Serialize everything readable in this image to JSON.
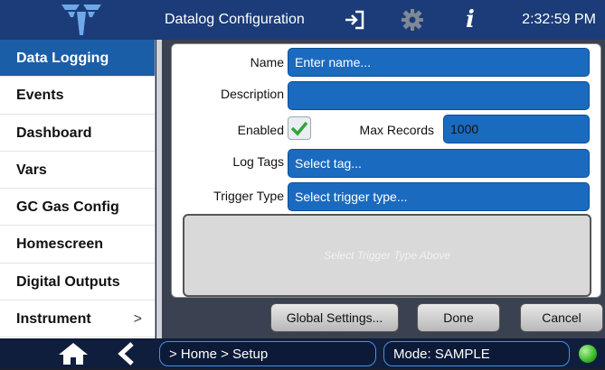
{
  "header": {
    "title": "Datalog Configuration",
    "time": "2:32:59 PM",
    "icons": [
      "teledyne-logo-icon",
      "exit-icon",
      "gear-icon",
      "info-icon"
    ]
  },
  "sidebar": {
    "items": [
      {
        "label": "Data Logging",
        "active": true
      },
      {
        "label": "Events"
      },
      {
        "label": "Dashboard"
      },
      {
        "label": "Vars"
      },
      {
        "label": "GC Gas Config"
      },
      {
        "label": "Homescreen"
      },
      {
        "label": "Digital Outputs"
      },
      {
        "label": "Instrument",
        "chevron": ">"
      }
    ]
  },
  "form": {
    "name_label": "Name",
    "name_placeholder": "Enter name...",
    "description_label": "Description",
    "description_value": "",
    "enabled_label": "Enabled",
    "enabled_checked": true,
    "max_records_label": "Max Records",
    "max_records_value": "1000",
    "log_tags_label": "Log Tags",
    "log_tags_placeholder": "Select tag...",
    "trigger_type_label": "Trigger Type",
    "trigger_type_placeholder": "Select trigger type...",
    "trigger_area_text": "Select Trigger Type Above"
  },
  "buttons": {
    "global_settings": "Global Settings...",
    "done": "Done",
    "cancel": "Cancel"
  },
  "status": {
    "breadcrumb": "> Home > Setup",
    "mode": "Mode: SAMPLE",
    "indicator_color": "#3fbf2f"
  },
  "colors": {
    "accent": "#1a6bbf",
    "topbar": "#1b3c78"
  }
}
